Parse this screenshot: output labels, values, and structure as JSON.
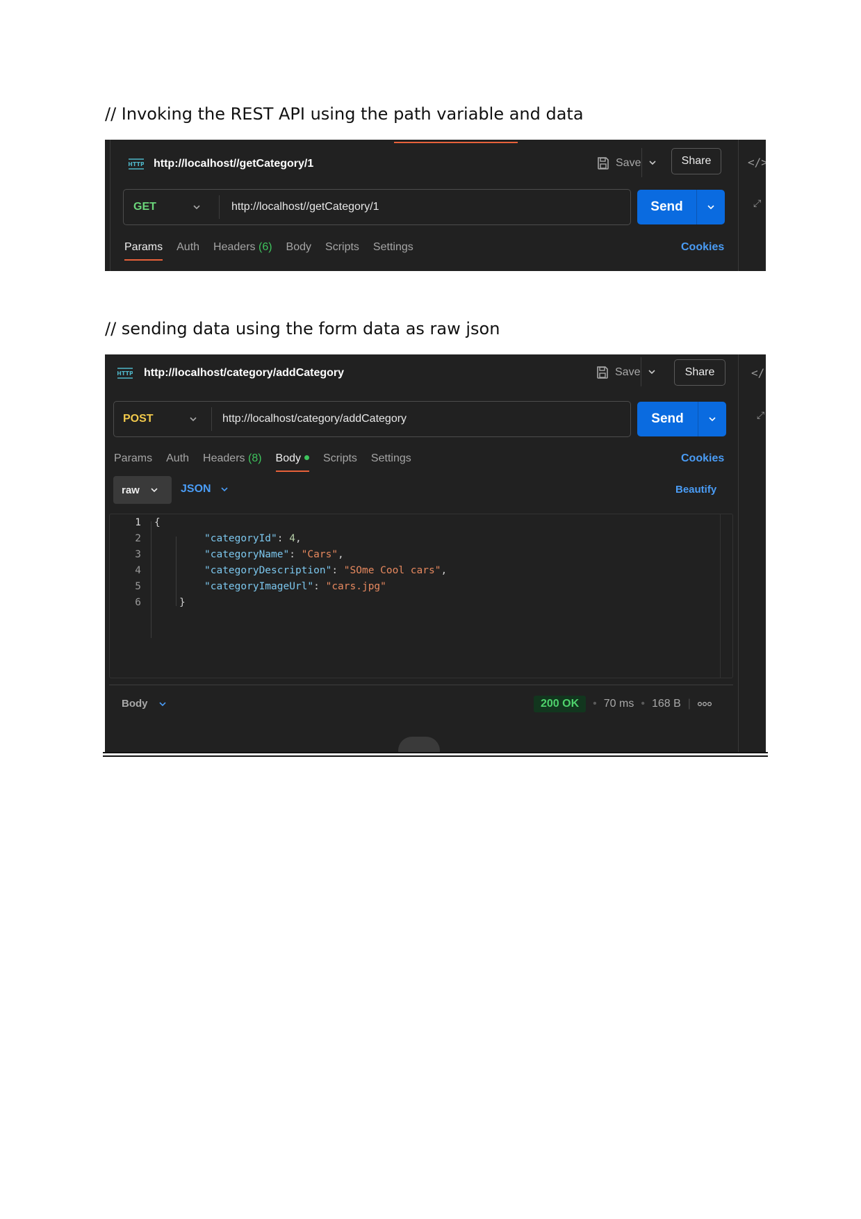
{
  "captions": {
    "first": "// Invoking the REST API using the path variable and data",
    "second": "// sending data using the form data as raw json"
  },
  "colors": {
    "panel_bg": "#212121",
    "accent_orange": "#e8613a",
    "link_blue": "#4a9cf5",
    "send_blue": "#0a6be0",
    "get_green": "#6bd67b",
    "post_yellow": "#f1c94b",
    "status_green": "#4ed26c"
  },
  "icons": {
    "http": "http-request-icon",
    "save": "floppy-disk-icon",
    "caret": "chevron-down-icon",
    "code": "code-icon",
    "expand": "expand-arrows-icon",
    "more": "more-options-icon"
  },
  "request1": {
    "title": "http://localhost//getCategory/1",
    "save_label": "Save",
    "share_label": "Share",
    "method": "GET",
    "url": "http://localhost//getCategory/1",
    "send_label": "Send",
    "tabs": [
      {
        "label": "Params",
        "count": "",
        "dot": false,
        "active": true
      },
      {
        "label": "Auth",
        "count": "",
        "dot": false,
        "active": false
      },
      {
        "label": "Headers",
        "count": "(6)",
        "dot": false,
        "active": false
      },
      {
        "label": "Body",
        "count": "",
        "dot": false,
        "active": false
      },
      {
        "label": "Scripts",
        "count": "",
        "dot": false,
        "active": false
      },
      {
        "label": "Settings",
        "count": "",
        "dot": false,
        "active": false
      }
    ],
    "cookies_label": "Cookies",
    "side_code_glyph": "</>"
  },
  "request2": {
    "title": "http://localhost/category/addCategory",
    "save_label": "Save",
    "share_label": "Share",
    "method": "POST",
    "url": "http://localhost/category/addCategory",
    "send_label": "Send",
    "tabs": [
      {
        "label": "Params",
        "count": "",
        "dot": false,
        "active": false
      },
      {
        "label": "Auth",
        "count": "",
        "dot": false,
        "active": false
      },
      {
        "label": "Headers",
        "count": "(8)",
        "dot": false,
        "active": false
      },
      {
        "label": "Body",
        "count": "",
        "dot": true,
        "active": true
      },
      {
        "label": "Scripts",
        "count": "",
        "dot": false,
        "active": false
      },
      {
        "label": "Settings",
        "count": "",
        "dot": false,
        "active": false
      }
    ],
    "cookies_label": "Cookies",
    "body_mode": "raw",
    "body_format": "JSON",
    "beautify_label": "Beautify",
    "side_code_glyph": "</",
    "code_lines": [
      {
        "n": "1",
        "indent": 0,
        "tokens": [
          {
            "t": "{",
            "c": "p"
          }
        ]
      },
      {
        "n": "2",
        "indent": 2,
        "tokens": [
          {
            "t": "\"categoryId\"",
            "c": "k"
          },
          {
            "t": ": ",
            "c": "p"
          },
          {
            "t": "4",
            "c": "n"
          },
          {
            "t": ",",
            "c": "p"
          }
        ]
      },
      {
        "n": "3",
        "indent": 2,
        "tokens": [
          {
            "t": "\"categoryName\"",
            "c": "k"
          },
          {
            "t": ": ",
            "c": "p"
          },
          {
            "t": "\"Cars\"",
            "c": "s"
          },
          {
            "t": ",",
            "c": "p"
          }
        ]
      },
      {
        "n": "4",
        "indent": 2,
        "tokens": [
          {
            "t": "\"categoryDescription\"",
            "c": "k"
          },
          {
            "t": ": ",
            "c": "p"
          },
          {
            "t": "\"SOme Cool cars\"",
            "c": "s"
          },
          {
            "t": ",",
            "c": "p"
          }
        ]
      },
      {
        "n": "5",
        "indent": 2,
        "tokens": [
          {
            "t": "\"categoryImageUrl\"",
            "c": "k"
          },
          {
            "t": ": ",
            "c": "p"
          },
          {
            "t": "\"cars.jpg\"",
            "c": "s"
          }
        ]
      },
      {
        "n": "6",
        "indent": 1,
        "tokens": [
          {
            "t": "}",
            "c": "p"
          }
        ]
      }
    ],
    "response": {
      "label": "Body",
      "status": "200 OK",
      "time": "70 ms",
      "size": "168 B"
    }
  }
}
